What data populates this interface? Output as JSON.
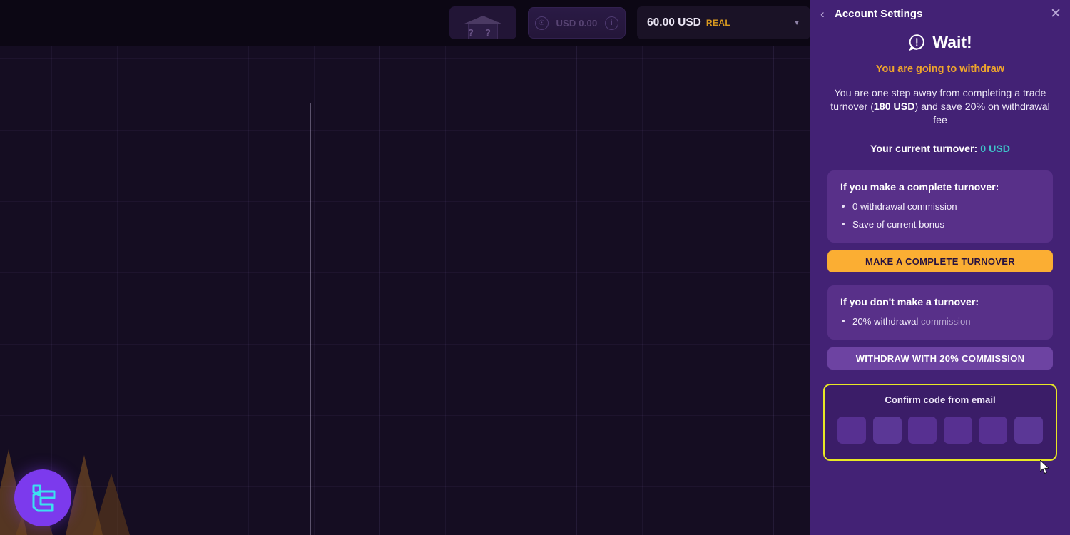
{
  "topbar": {
    "mystery_box": {
      "icon": "mystery-box-icon",
      "q1": "?",
      "q2": "?"
    },
    "bonus": {
      "left_icon": "bonus-coin-icon",
      "amount": "USD 0.00",
      "info_icon": "info-icon"
    },
    "balance": {
      "amount": "60.00 USD",
      "account_type": "REAL",
      "caret": "▼"
    }
  },
  "brand": {
    "name": "platform-logo"
  },
  "panel": {
    "back_icon": "chevron-left-icon",
    "title": "Account Settings",
    "close_icon": "close-icon",
    "alert_icon": "exclamation-bubble-icon",
    "heading": "Wait!",
    "subheading": "You are going to withdraw",
    "intro_part1": "You are one step away from completing a trade turnover (",
    "intro_bold": "180 USD",
    "intro_part2": ") and save 20% on withdrawal fee",
    "turnover_label": "Your current turnover:",
    "turnover_value": "0 USD",
    "card_complete": {
      "title": "If you make a complete turnover:",
      "bullets": [
        "0 withdrawal commission",
        "Save of current bonus"
      ],
      "button": "MAKE A COMPLETE TURNOVER"
    },
    "card_no_turnover": {
      "title": "If you don't make a turnover:",
      "bullet_strong": "20% withdrawal",
      "bullet_muted": "commission",
      "button": "WITHDRAW WITH 20% COMMISSION"
    },
    "confirm": {
      "label": "Confirm code from email",
      "cells": [
        "",
        "",
        "",
        "",
        "",
        ""
      ]
    }
  },
  "colors": {
    "panel_bg": "#432275",
    "card_bg": "#583089",
    "accent_orange": "#fbae33",
    "subhead_orange": "#f0a62c",
    "turnover_teal": "#3fc3c9",
    "highlight_yellow": "#e8e825",
    "secondary_button": "#6d43a2",
    "chart_bg": "#150d22",
    "logo_purple": "#7c3aed",
    "logo_cyan": "#3ce0f0"
  }
}
